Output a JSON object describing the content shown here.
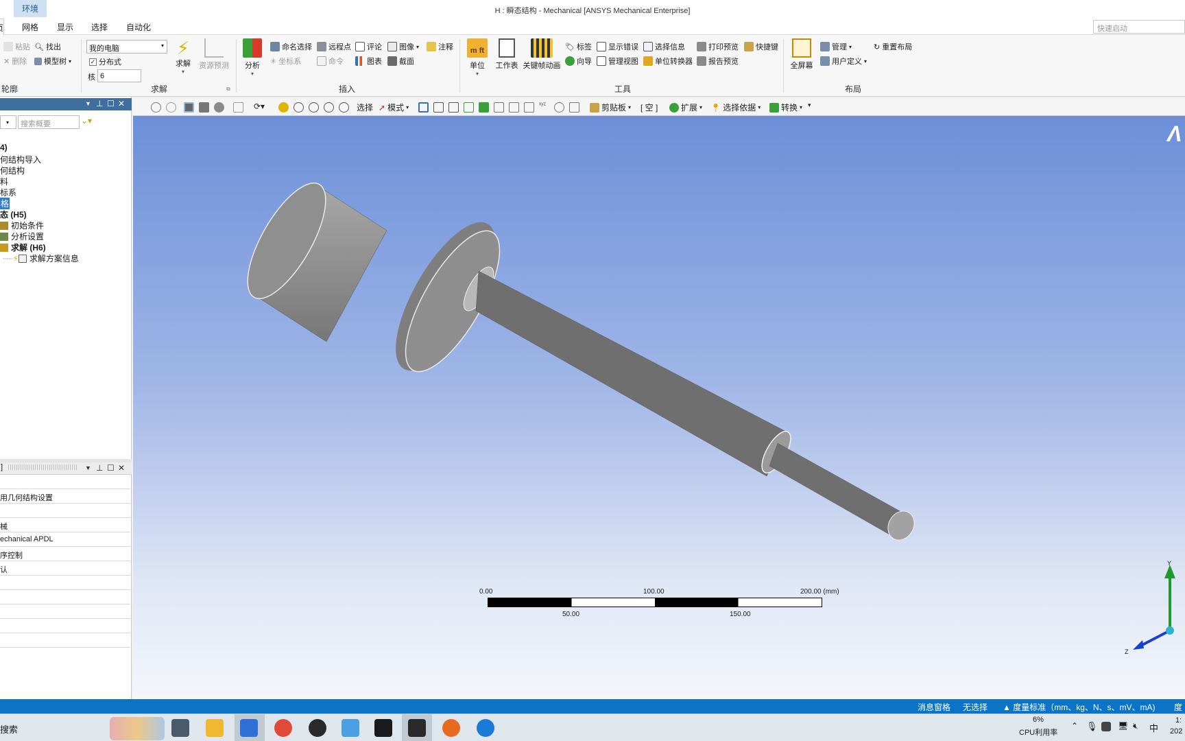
{
  "window": {
    "context_tab": "环境",
    "title": "H : 瞬态结构 - Mechanical [ANSYS Mechanical Enterprise]"
  },
  "ribbon_tabs": [
    "页",
    "网格",
    "显示",
    "选择",
    "自动化"
  ],
  "quick_launch_placeholder": "快速启动",
  "ribbon": {
    "outline": {
      "paste": "粘贴",
      "find": "找出",
      "delete": "删除",
      "tree": "模型树",
      "label": "轮廓"
    },
    "solve": {
      "location": "我的电脑",
      "distributed": "分布式",
      "distributed_checked": true,
      "cores_label": "核",
      "cores_value": "6",
      "solve_button": "求解",
      "resource_predict": "资源预测",
      "label": "求解"
    },
    "insert": {
      "analysis": "分析",
      "named_selection": "命名选择",
      "remote_point": "远程点",
      "comment": "评论",
      "image": "图像",
      "annotation": "注释",
      "coord_system": "坐标系",
      "command": "命令",
      "chart": "图表",
      "section": "截面",
      "label": "插入"
    },
    "tools": {
      "units": "单位",
      "worksheet": "工作表",
      "keyframe": "关键帧动画",
      "tag": "标签",
      "show_errors": "显示错误",
      "selection_info": "选择信息",
      "print_preview": "打印预览",
      "shortcuts": "快捷键",
      "wizard": "向导",
      "manage_views": "管理视图",
      "unit_converter": "单位转换器",
      "report_preview": "报告预览",
      "label": "工具"
    },
    "layout": {
      "fullscreen": "全屏幕",
      "manage": "管理",
      "user_defined": "用户定义",
      "reset_layout": "重置布局",
      "label": "布局"
    }
  },
  "outline_panel": {
    "search_placeholder": "搜索概要",
    "items": [
      {
        "text": "4)",
        "bold": true
      },
      {
        "text": "何结构导入",
        "bold": false
      },
      {
        "text": "何结构",
        "bold": false
      },
      {
        "text": "料",
        "bold": false
      },
      {
        "text": "标系",
        "bold": false
      },
      {
        "text": "格",
        "bold": false
      },
      {
        "text": "态 (H5)",
        "bold": true
      },
      {
        "text": "初始条件",
        "bold": false
      },
      {
        "text": "分析设置",
        "bold": false
      },
      {
        "text": "求解 (H6)",
        "bold": true
      },
      {
        "text": "求解方案信息",
        "bold": false
      }
    ]
  },
  "details_panel": {
    "header": "]",
    "rows": [
      "",
      "用几何结构设置",
      "",
      "械",
      "echanical APDL",
      "序控制",
      "认",
      "",
      "",
      "",
      "",
      ""
    ]
  },
  "graphics_toolbar": {
    "select": "选择",
    "mode": "模式",
    "clipboard": "剪贴板",
    "empty": "[ 空 ]",
    "extend": "扩展",
    "select_by": "选择依据",
    "convert": "转换"
  },
  "viewport": {
    "logo": "Λ",
    "scale_bar": {
      "top_labels": [
        "0.00",
        "100.00",
        "200.00 (mm)"
      ],
      "bottom_labels": [
        "50.00",
        "150.00"
      ]
    },
    "triad": {
      "y": "Y",
      "z": "Z"
    }
  },
  "status_bar": {
    "messages": "消息窗格",
    "selection": "无选择",
    "units": "度量标准（mm、kg、N、s、mV、mA)",
    "degree": "度"
  },
  "taskbar": {
    "search": "搜索",
    "cpu_percent": "6%",
    "cpu_label": "CPU利用率",
    "ime": "中",
    "clock_time": "1:",
    "clock_date": "202",
    "apps": [
      "task-view",
      "file-explorer",
      "feishu",
      "chrome",
      "app-penguin",
      "baidu-netdisk",
      "workbench",
      "mechanical",
      "podcast",
      "app-swirl"
    ]
  },
  "colors": {
    "accent": "#0b74c7",
    "panel_header": "#3f6f9f",
    "viewport_top": "#6c8fd8",
    "viewport_bottom": "#f4f6fb",
    "model": "#8c8c8c"
  }
}
